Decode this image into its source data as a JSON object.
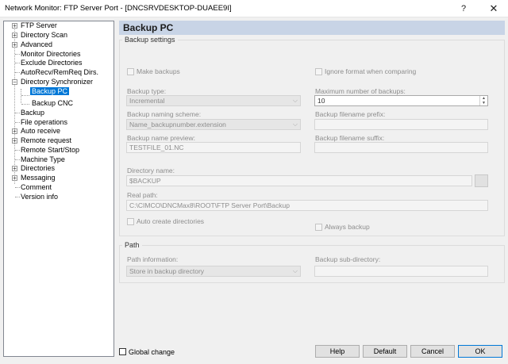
{
  "window": {
    "title": "Network Monitor: FTP Server Port - [DNCSRVDESKTOP-DUAEE9I]",
    "help_glyph": "?",
    "close_glyph": "✕"
  },
  "tree": {
    "items": [
      {
        "label": "FTP Server",
        "expander": "+"
      },
      {
        "label": "Directory Scan",
        "expander": "+"
      },
      {
        "label": "Advanced",
        "expander": "+"
      },
      {
        "label": "Monitor Directories",
        "expander": ""
      },
      {
        "label": "Exclude Directories",
        "expander": ""
      },
      {
        "label": "AutoRecv/RemReq Dirs.",
        "expander": ""
      },
      {
        "label": "Directory Synchronizer",
        "expander": "−"
      },
      {
        "label": "Backup PC",
        "expander": ""
      },
      {
        "label": "Backup CNC",
        "expander": ""
      },
      {
        "label": "Backup",
        "expander": ""
      },
      {
        "label": "File operations",
        "expander": ""
      },
      {
        "label": "Auto receive",
        "expander": "+"
      },
      {
        "label": "Remote request",
        "expander": "+"
      },
      {
        "label": "Remote Start/Stop",
        "expander": ""
      },
      {
        "label": "Machine Type",
        "expander": ""
      },
      {
        "label": "Directories",
        "expander": "+"
      },
      {
        "label": "Messaging",
        "expander": "+"
      },
      {
        "label": "Comment",
        "expander": ""
      },
      {
        "label": "Version info",
        "expander": ""
      }
    ]
  },
  "panel": {
    "header": "Backup PC",
    "backup_settings": {
      "group_label": "Backup settings",
      "make_backups_label": "Make backups",
      "ignore_format_label": "Ignore format when comparing",
      "backup_type_label": "Backup type:",
      "backup_type_value": "Incremental",
      "max_backups_label": "Maximum number of backups:",
      "max_backups_value": "10",
      "naming_scheme_label": "Backup naming scheme:",
      "naming_scheme_value": "Name_backupnumber.extension",
      "filename_prefix_label": "Backup filename prefix:",
      "filename_prefix_value": "",
      "name_preview_label": "Backup name preview:",
      "name_preview_value": "TESTFILE_01.NC",
      "filename_suffix_label": "Backup filename suffix:",
      "filename_suffix_value": "",
      "directory_name_label": "Directory name:",
      "directory_name_value": "$BACKUP",
      "real_path_label": "Real path:",
      "real_path_value": "C:\\CIMCO\\DNCMax8\\ROOT\\FTP Server Port\\Backup",
      "auto_create_label": "Auto create directories",
      "always_backup_label": "Always backup"
    },
    "path": {
      "group_label": "Path",
      "path_info_label": "Path information:",
      "path_info_value": "Store in backup directory",
      "sub_directory_label": "Backup sub-directory:",
      "sub_directory_value": ""
    }
  },
  "footer": {
    "global_change_label": "Global change",
    "help_button": "Help",
    "default_button": "Default",
    "cancel_button": "Cancel",
    "ok_button": "OK"
  },
  "colors": {
    "header_band": "#c8d4e6",
    "selection": "#0078d7"
  }
}
